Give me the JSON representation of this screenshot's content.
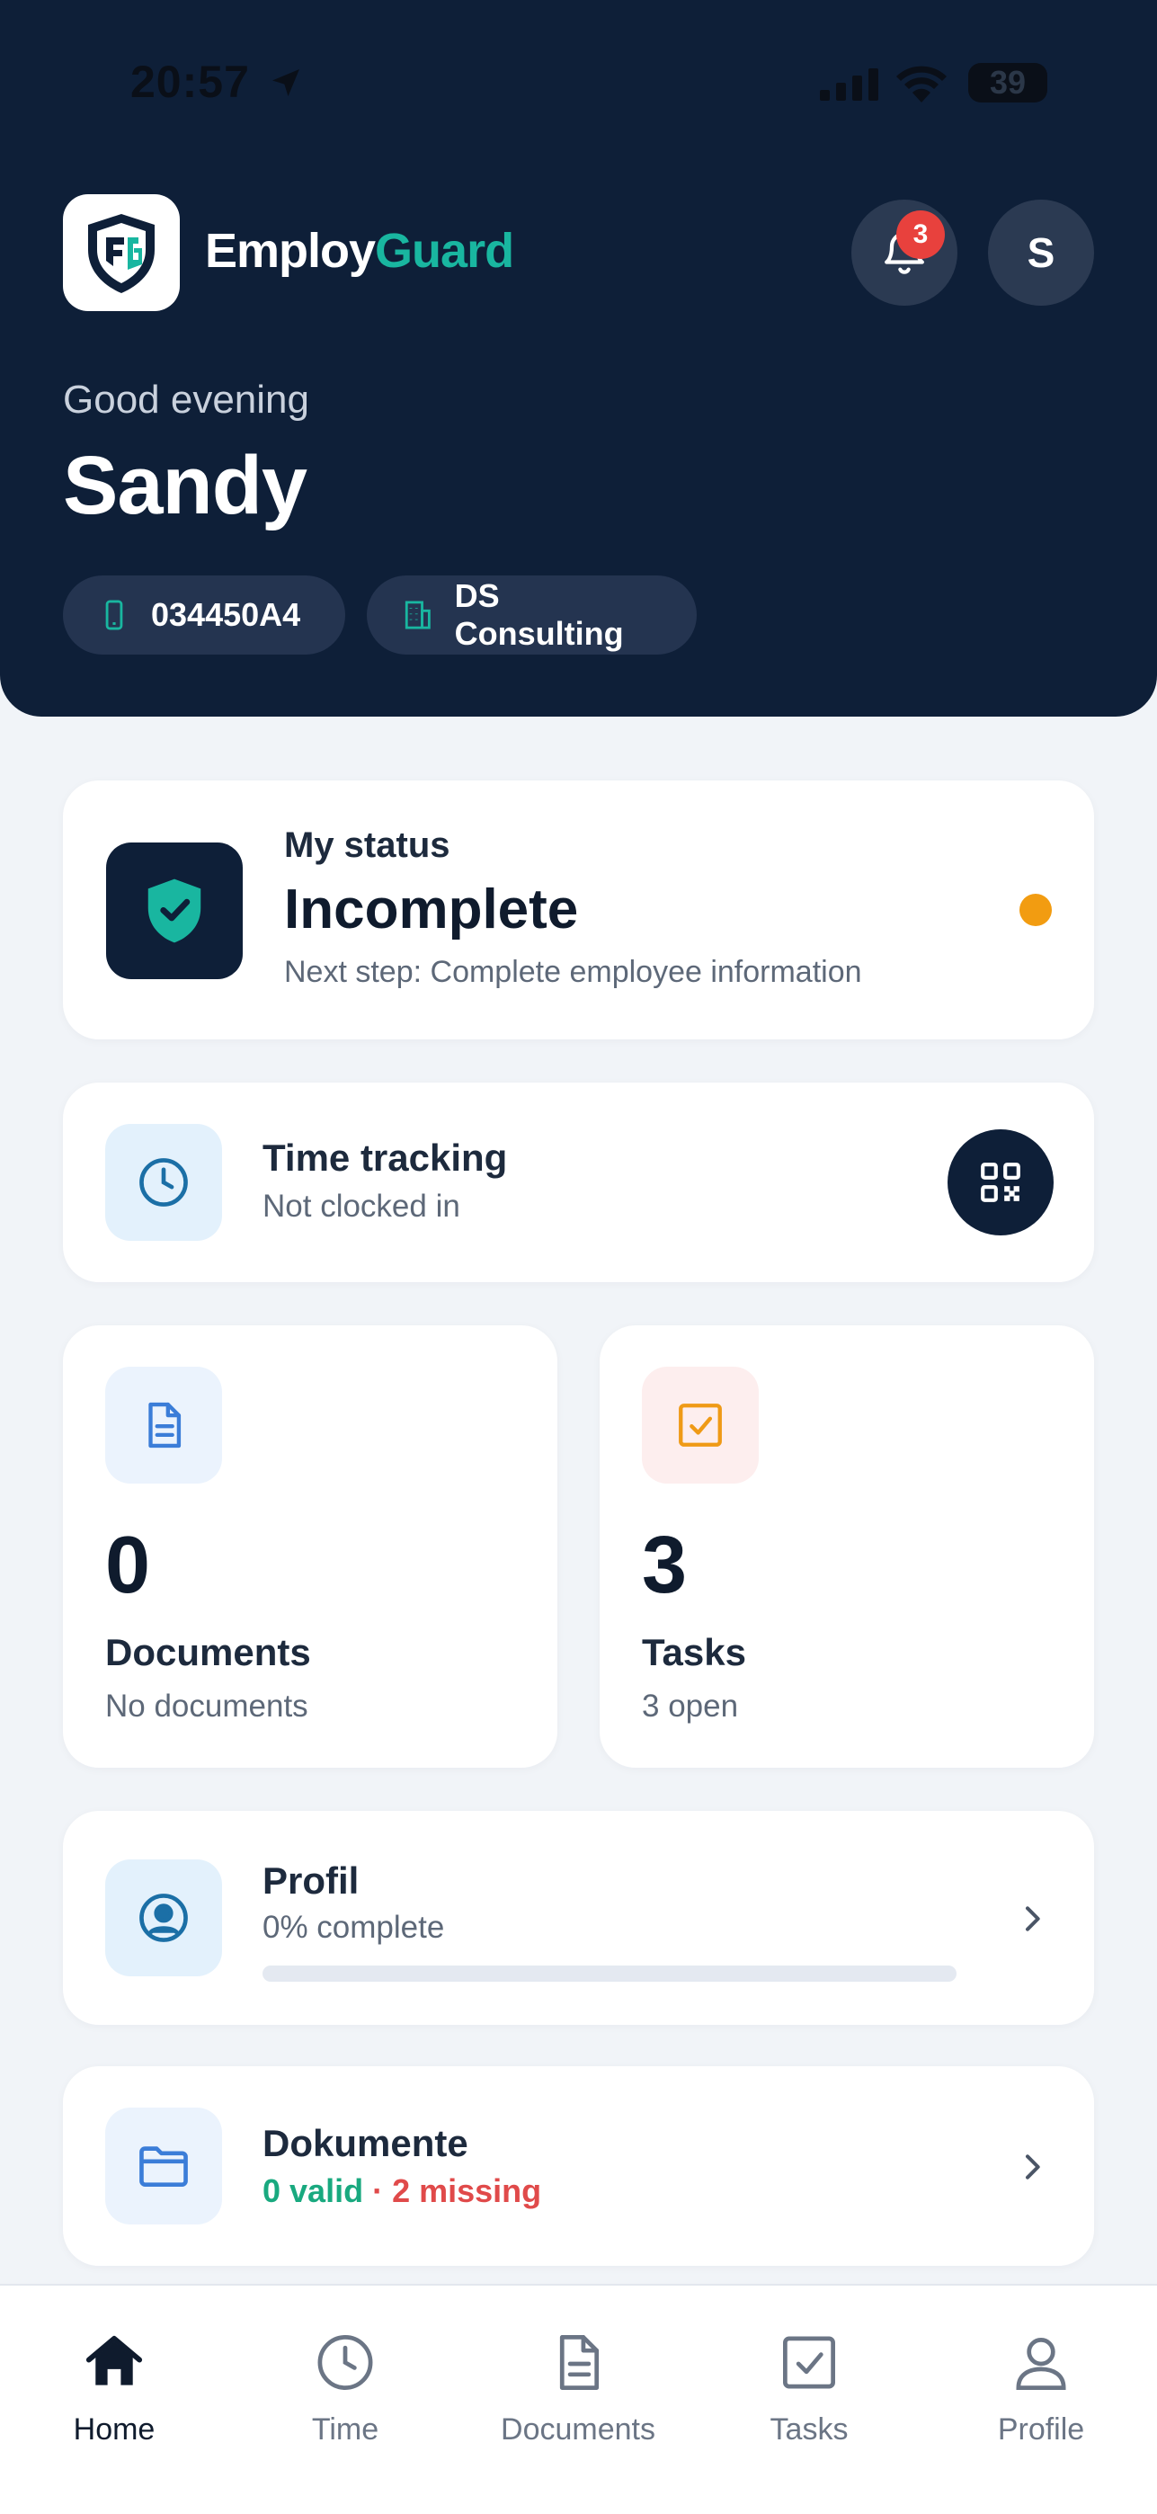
{
  "status_bar": {
    "time": "20:57",
    "battery": "39"
  },
  "header": {
    "brand_primary": "Employ",
    "brand_accent": "Guard",
    "notification_count": "3",
    "avatar_initial": "S",
    "greeting": "Good evening",
    "user_name": "Sandy",
    "chips": {
      "employee_id": "034450A4",
      "company": "DS Consulting"
    }
  },
  "status_card": {
    "label": "My status",
    "value": "Incomplete",
    "next_step": "Next step: Complete employee information",
    "indicator_color": "#f29c11"
  },
  "time_tracking": {
    "title": "Time tracking",
    "subtitle": "Not clocked in"
  },
  "documents_stat": {
    "count": "0",
    "label": "Documents",
    "subtitle": "No documents"
  },
  "tasks_stat": {
    "count": "3",
    "label": "Tasks",
    "subtitle": "3 open"
  },
  "profile_card": {
    "title": "Profil",
    "subtitle": "0% complete",
    "progress": 0
  },
  "dokumente_card": {
    "title": "Dokumente",
    "valid": "0 valid",
    "separator": " · ",
    "missing": "2 missing"
  },
  "nav": {
    "home": "Home",
    "time": "Time",
    "documents": "Documents",
    "tasks": "Tasks",
    "profile": "Profile",
    "active": "home"
  },
  "colors": {
    "navy": "#0e1f38",
    "teal": "#19b6a0",
    "badge_red": "#e8413d",
    "valid_green": "#19a97f",
    "missing_red": "#e04a4a"
  },
  "icons": [
    "location-arrow-icon",
    "signal-icon",
    "wifi-icon",
    "battery-icon",
    "bell-icon",
    "phone-icon",
    "building-icon",
    "shield-check-icon",
    "clock-icon",
    "qr-code-icon",
    "document-icon",
    "checkbox-icon",
    "user-circle-icon",
    "folder-icon",
    "chevron-right-icon",
    "home-icon",
    "user-icon"
  ]
}
